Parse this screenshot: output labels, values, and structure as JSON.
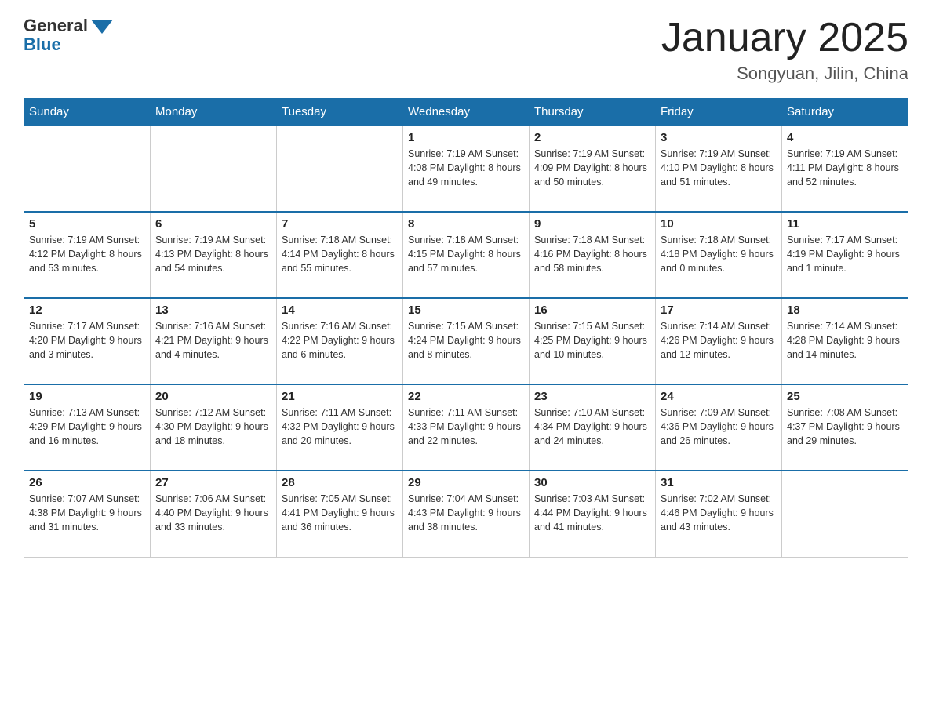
{
  "header": {
    "logo_general": "General",
    "logo_blue": "Blue",
    "title": "January 2025",
    "subtitle": "Songyuan, Jilin, China"
  },
  "days_of_week": [
    "Sunday",
    "Monday",
    "Tuesday",
    "Wednesday",
    "Thursday",
    "Friday",
    "Saturday"
  ],
  "weeks": [
    [
      {
        "day": "",
        "info": ""
      },
      {
        "day": "",
        "info": ""
      },
      {
        "day": "",
        "info": ""
      },
      {
        "day": "1",
        "info": "Sunrise: 7:19 AM\nSunset: 4:08 PM\nDaylight: 8 hours\nand 49 minutes."
      },
      {
        "day": "2",
        "info": "Sunrise: 7:19 AM\nSunset: 4:09 PM\nDaylight: 8 hours\nand 50 minutes."
      },
      {
        "day": "3",
        "info": "Sunrise: 7:19 AM\nSunset: 4:10 PM\nDaylight: 8 hours\nand 51 minutes."
      },
      {
        "day": "4",
        "info": "Sunrise: 7:19 AM\nSunset: 4:11 PM\nDaylight: 8 hours\nand 52 minutes."
      }
    ],
    [
      {
        "day": "5",
        "info": "Sunrise: 7:19 AM\nSunset: 4:12 PM\nDaylight: 8 hours\nand 53 minutes."
      },
      {
        "day": "6",
        "info": "Sunrise: 7:19 AM\nSunset: 4:13 PM\nDaylight: 8 hours\nand 54 minutes."
      },
      {
        "day": "7",
        "info": "Sunrise: 7:18 AM\nSunset: 4:14 PM\nDaylight: 8 hours\nand 55 minutes."
      },
      {
        "day": "8",
        "info": "Sunrise: 7:18 AM\nSunset: 4:15 PM\nDaylight: 8 hours\nand 57 minutes."
      },
      {
        "day": "9",
        "info": "Sunrise: 7:18 AM\nSunset: 4:16 PM\nDaylight: 8 hours\nand 58 minutes."
      },
      {
        "day": "10",
        "info": "Sunrise: 7:18 AM\nSunset: 4:18 PM\nDaylight: 9 hours\nand 0 minutes."
      },
      {
        "day": "11",
        "info": "Sunrise: 7:17 AM\nSunset: 4:19 PM\nDaylight: 9 hours\nand 1 minute."
      }
    ],
    [
      {
        "day": "12",
        "info": "Sunrise: 7:17 AM\nSunset: 4:20 PM\nDaylight: 9 hours\nand 3 minutes."
      },
      {
        "day": "13",
        "info": "Sunrise: 7:16 AM\nSunset: 4:21 PM\nDaylight: 9 hours\nand 4 minutes."
      },
      {
        "day": "14",
        "info": "Sunrise: 7:16 AM\nSunset: 4:22 PM\nDaylight: 9 hours\nand 6 minutes."
      },
      {
        "day": "15",
        "info": "Sunrise: 7:15 AM\nSunset: 4:24 PM\nDaylight: 9 hours\nand 8 minutes."
      },
      {
        "day": "16",
        "info": "Sunrise: 7:15 AM\nSunset: 4:25 PM\nDaylight: 9 hours\nand 10 minutes."
      },
      {
        "day": "17",
        "info": "Sunrise: 7:14 AM\nSunset: 4:26 PM\nDaylight: 9 hours\nand 12 minutes."
      },
      {
        "day": "18",
        "info": "Sunrise: 7:14 AM\nSunset: 4:28 PM\nDaylight: 9 hours\nand 14 minutes."
      }
    ],
    [
      {
        "day": "19",
        "info": "Sunrise: 7:13 AM\nSunset: 4:29 PM\nDaylight: 9 hours\nand 16 minutes."
      },
      {
        "day": "20",
        "info": "Sunrise: 7:12 AM\nSunset: 4:30 PM\nDaylight: 9 hours\nand 18 minutes."
      },
      {
        "day": "21",
        "info": "Sunrise: 7:11 AM\nSunset: 4:32 PM\nDaylight: 9 hours\nand 20 minutes."
      },
      {
        "day": "22",
        "info": "Sunrise: 7:11 AM\nSunset: 4:33 PM\nDaylight: 9 hours\nand 22 minutes."
      },
      {
        "day": "23",
        "info": "Sunrise: 7:10 AM\nSunset: 4:34 PM\nDaylight: 9 hours\nand 24 minutes."
      },
      {
        "day": "24",
        "info": "Sunrise: 7:09 AM\nSunset: 4:36 PM\nDaylight: 9 hours\nand 26 minutes."
      },
      {
        "day": "25",
        "info": "Sunrise: 7:08 AM\nSunset: 4:37 PM\nDaylight: 9 hours\nand 29 minutes."
      }
    ],
    [
      {
        "day": "26",
        "info": "Sunrise: 7:07 AM\nSunset: 4:38 PM\nDaylight: 9 hours\nand 31 minutes."
      },
      {
        "day": "27",
        "info": "Sunrise: 7:06 AM\nSunset: 4:40 PM\nDaylight: 9 hours\nand 33 minutes."
      },
      {
        "day": "28",
        "info": "Sunrise: 7:05 AM\nSunset: 4:41 PM\nDaylight: 9 hours\nand 36 minutes."
      },
      {
        "day": "29",
        "info": "Sunrise: 7:04 AM\nSunset: 4:43 PM\nDaylight: 9 hours\nand 38 minutes."
      },
      {
        "day": "30",
        "info": "Sunrise: 7:03 AM\nSunset: 4:44 PM\nDaylight: 9 hours\nand 41 minutes."
      },
      {
        "day": "31",
        "info": "Sunrise: 7:02 AM\nSunset: 4:46 PM\nDaylight: 9 hours\nand 43 minutes."
      },
      {
        "day": "",
        "info": ""
      }
    ]
  ]
}
